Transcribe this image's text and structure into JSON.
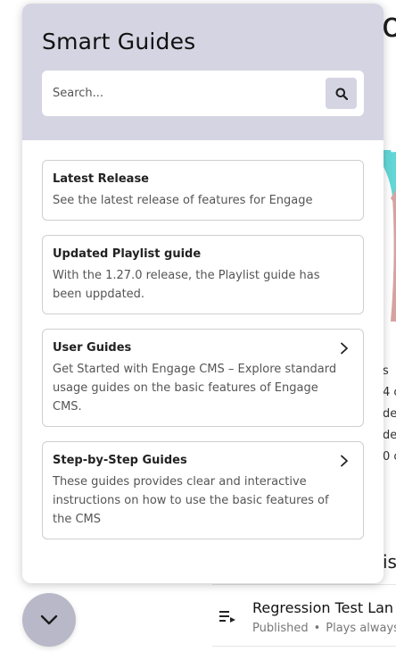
{
  "background": {
    "heading_fragment": "o",
    "legend_fragments": [
      "s",
      "4 c",
      "de",
      "de",
      "",
      "0 c"
    ],
    "section_fragment": "ist",
    "list_item": {
      "title": "Regression Test Lan",
      "status": "Published",
      "separator": "•",
      "meta": "Plays always"
    },
    "chart_colors": {
      "teal": "#63d6d6",
      "rose": "#d6a3a1"
    }
  },
  "panel": {
    "title": "Smart Guides",
    "search": {
      "placeholder": "Search...",
      "value": "",
      "button_icon": "search-icon"
    },
    "cards": [
      {
        "title": "Latest Release",
        "description": "See the latest release of features for Engage",
        "has_chevron": false
      },
      {
        "title": "Updated Playlist guide",
        "description": "With the 1.27.0 release, the Playlist guide has been uppdated.",
        "has_chevron": false
      },
      {
        "title": "User Guides",
        "description": "Get Started with Engage CMS – Explore standard usage guides on the basic features of Engage CMS.",
        "has_chevron": true
      },
      {
        "title": "Step-by-Step Guides",
        "description": "These guides provides clear and interactive instructions on how to use the basic features of the CMS",
        "has_chevron": true
      }
    ],
    "colors": {
      "header_bg": "#d5d4e2",
      "toggle_bg": "#b9b8c8"
    }
  },
  "toggle": {
    "icon": "chevron-down-icon"
  }
}
